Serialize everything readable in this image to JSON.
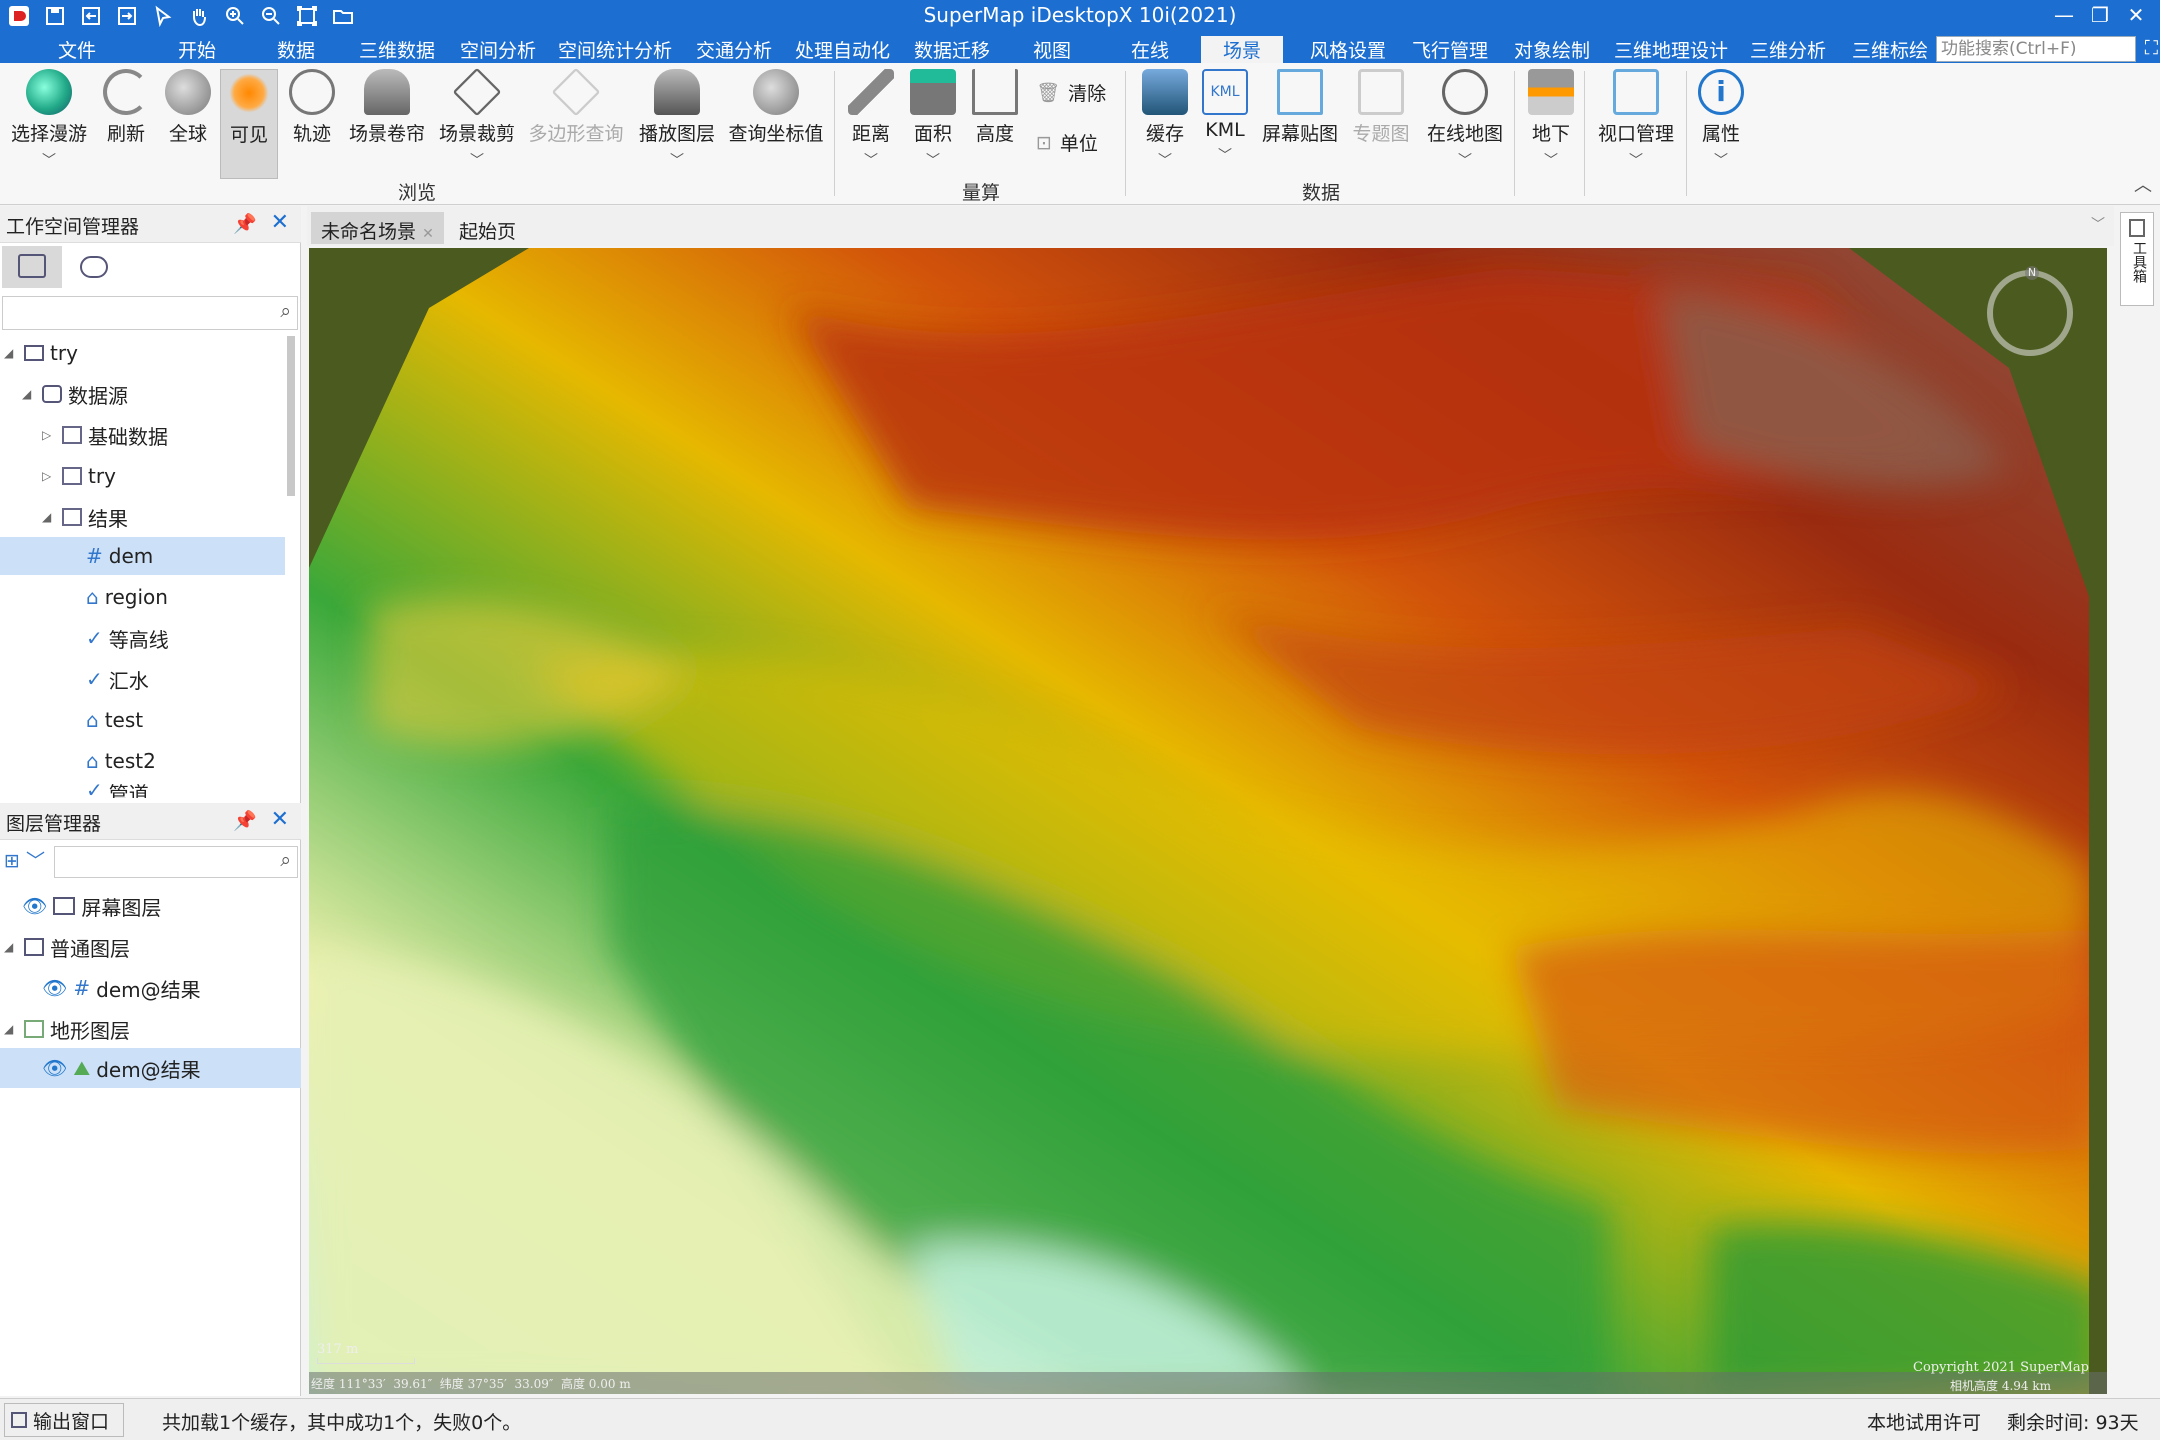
{
  "title": "SuperMap iDesktopX 10i(2021)",
  "colors": {
    "accent": "#1c6fd0"
  },
  "menu": [
    "文件",
    "开始",
    "数据",
    "三维数据",
    "空间分析",
    "空间统计分析",
    "交通分析",
    "处理自动化",
    "数据迁移",
    "视图",
    "在线",
    "场景",
    "风格设置",
    "飞行管理",
    "对象绘制",
    "三维地理设计",
    "三维分析",
    "三维标绘"
  ],
  "search_placeholder": "功能搜索(Ctrl+F)",
  "ribbon": {
    "browse": {
      "group": "浏览",
      "buttons": [
        "选择漫游",
        "刷新",
        "全球",
        "可见",
        "轨迹",
        "场景卷帘",
        "场景裁剪",
        "多边形查询",
        "播放图层",
        "查询坐标值"
      ]
    },
    "measure": {
      "group": "量算",
      "buttons": [
        "距离",
        "面积",
        "高度"
      ],
      "small": [
        "清除",
        "单位"
      ]
    },
    "data": {
      "group": "数据",
      "buttons": [
        "缓存",
        "KML",
        "屏幕贴图",
        "专题图",
        "在线地图",
        "地下",
        "视口管理",
        "属性"
      ]
    }
  },
  "workspace": {
    "title": "工作空间管理器",
    "tree": [
      "try",
      "数据源",
      "基础数据",
      "try",
      "结果",
      "dem",
      "region",
      "等高线",
      "汇水",
      "test",
      "test2",
      "管道"
    ]
  },
  "layers": {
    "title": "图层管理器",
    "tree": [
      "屏幕图层",
      "普通图层",
      "dem@结果",
      "地形图层",
      "dem@结果"
    ]
  },
  "tabs": [
    "未命名场景",
    "起始页"
  ],
  "map": {
    "scale": "317 m",
    "coords": "经度 111°33′  39.61″  纬度 37°35′  33.09″  高度 0.00 m",
    "copyright": "Copyright 2021 SuperMap",
    "cam": "相机高度 4.94 km",
    "compass": "N"
  },
  "status": {
    "output": "输出窗口",
    "message": "共加载1个缓存，其中成功1个，失败0个。",
    "license": "本地试用许可",
    "remaining": "剩余时间: 93天"
  },
  "right_panel": "工具箱"
}
